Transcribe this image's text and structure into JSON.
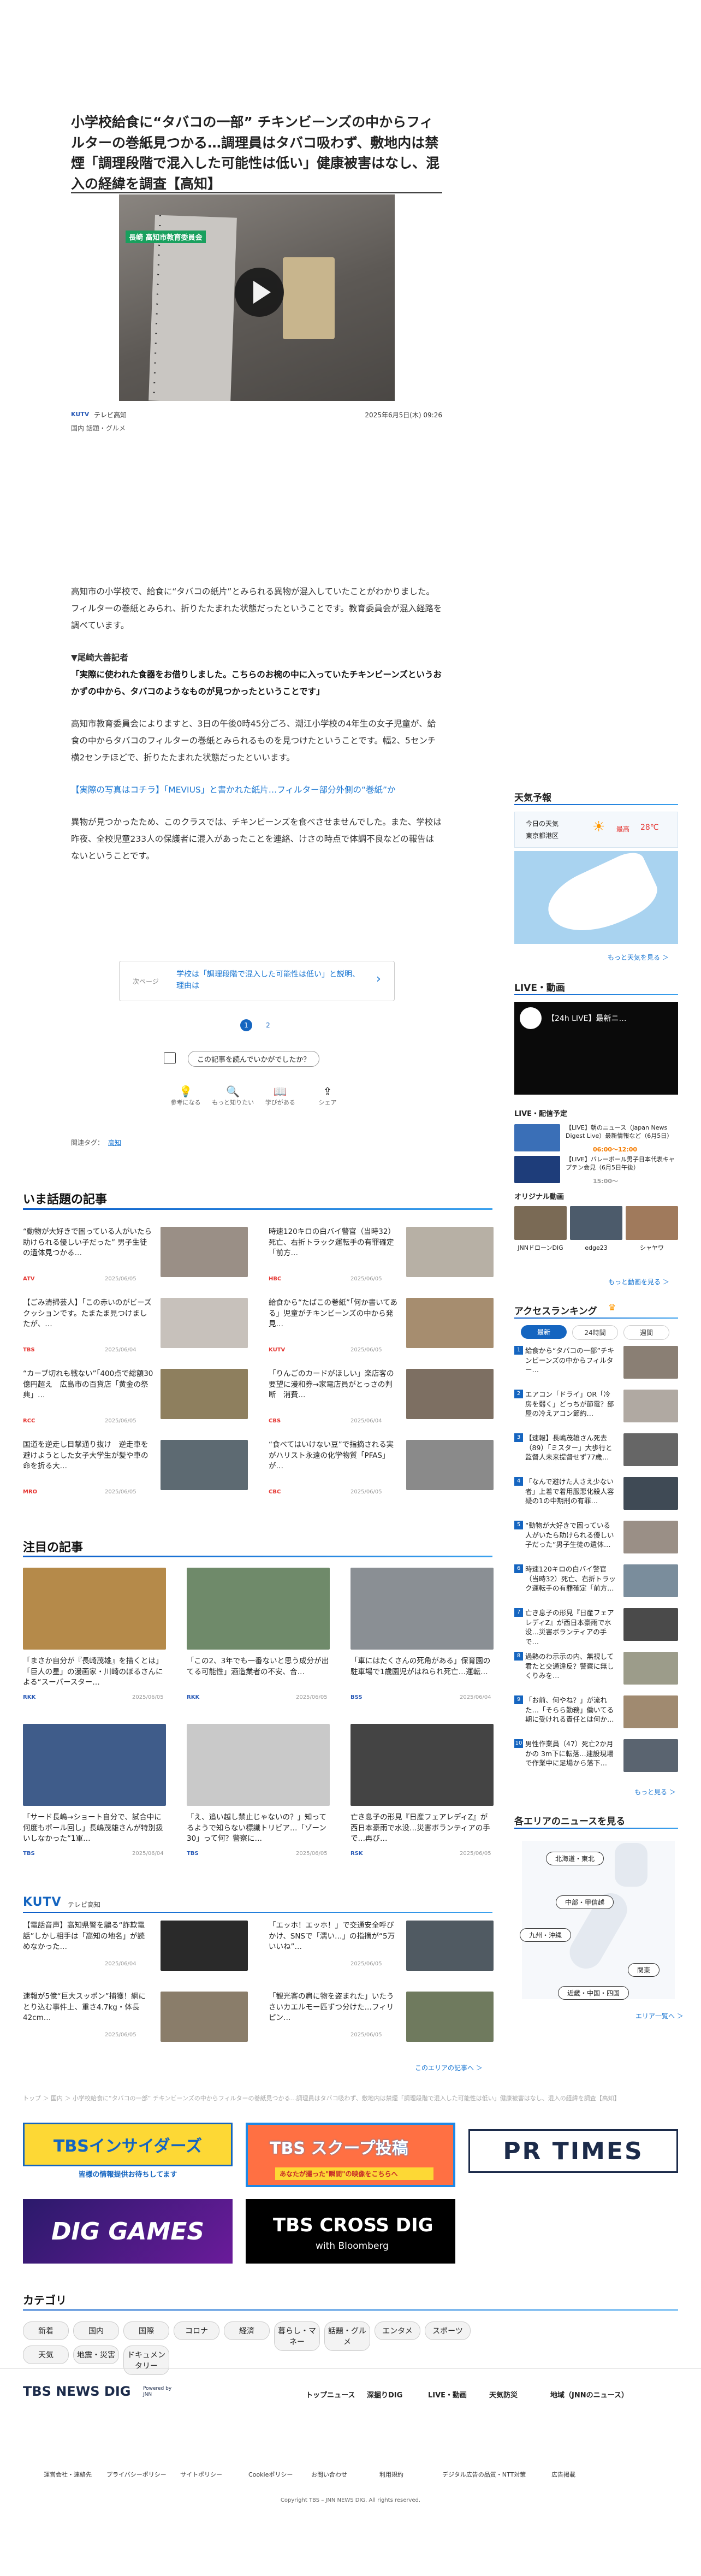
{
  "article": {
    "title": "小学校給食に“タバコの一部” チキンビーンズの中からフィルターの巻紙見つかる…調理員はタバコ吸わず、敷地内は禁煙「調理段階で混入した可能性は低い」健康被害はなし、混入の経緯を調査【高知】",
    "video_caption": "長崎 高知市教育委員会",
    "station": "テレビ高知",
    "station_logo": "KUTV",
    "date": "2025年6月5日(木) 09:26",
    "categories": "国内  話題・グルメ",
    "p1": "高知市の小学校で、給食に“タバコの紙片”とみられる異物が混入していたことがわかりました。フィルターの巻紙とみられ、折りたたまれた状態だったということです。教育委員会が混入経路を調べています。",
    "quote_head": "▼尾崎大善記者",
    "quote": "「実際に使われた食器をお借りしました。こちらのお椀の中に入っていたチキンビーンズというおかずの中から、タバコのようなものが見つかったということです」",
    "p2": "高知市教育委員会によりますと、3日の午後0時45分ごろ、潮江小学校の4年生の女子児童が、給食の中からタバコのフィルターの巻紙とみられるものを見つけたということです。幅2、5センチ横2センチほどで、折りたたまれた状態だったといいます。",
    "link": "【実際の写真はコチラ】「MEVIUS」と書かれた紙片…フィルター部分外側の“巻紙”か",
    "p3": "異物が見つかったため、このクラスでは、チキンビーンズを食べさせませんでした。また、学校は昨夜、全校児童233人の保護者に混入があったことを連絡、けさの時点で体調不良などの報告はないということです。",
    "next_label": "次ページ",
    "next_title": "学校は「調理段階で混入した可能性は低い」と説明、理由は",
    "page1": "1",
    "page2": "2",
    "feedback": "この記事を読んでいかがでしたか？",
    "reactions": [
      "参考になる",
      "もっと知りたい",
      "学びがある",
      "シェア"
    ],
    "tags_label": "関連タグ：",
    "tag": "高知"
  },
  "trending": {
    "heading": "いま話題の記事",
    "items": [
      {
        "title": "“動物が大好きで困っている人がいたら助けられる優しい子だった” 男子生徒の遺体見つかる…",
        "date": "2025/06/05",
        "src": "ATV"
      },
      {
        "title": "時速120キロの白バイ警官（当時32）死亡、右折トラック運転手の有罪確定「前方…",
        "date": "2025/06/05",
        "src": "HBC"
      },
      {
        "title": "【ごみ清掃芸人】「この赤いのがビーズクッションです。たまたま見つけましたが、…",
        "date": "2025/06/04",
        "src": "TBS"
      },
      {
        "title": "給食から“たばこの巻紙”「何か書いてある」児童がチキンビーンズの中から発見…",
        "date": "2025/06/05",
        "src": "KUTV"
      },
      {
        "title": "“カーブ切れも戦ない”「400点で総額30億円超え　広島市の百貨店「黄金の祭典」…",
        "date": "2025/06/05",
        "src": "RCC"
      },
      {
        "title": "「りんごのカードがほしい」楽店客の要望に漫和券→家電店員がとっさの判断　消費…",
        "date": "2025/06/04",
        "src": "CBS"
      },
      {
        "title": "国道を逆走し目撃通り抜け　逆走車を避けようとした女子大学生が髪や車の命を折る大…",
        "date": "2025/06/05",
        "src": "MRO"
      },
      {
        "title": "“食べてはいけない豆”で指摘される実がハリスト永遠の化学物質「PFAS」が…",
        "date": "2025/06/05",
        "src": "CBC"
      }
    ]
  },
  "featured": {
    "heading": "注目の記事",
    "items": [
      {
        "title": "「まさか自分が『長崎茂雄』を描くとは」「巨人の星」の漫画家・川崎のぼるさんによる“スーパースター…",
        "date": "2025/06/05",
        "src": "RKK"
      },
      {
        "title": "「この2、3年でも一番ないと思う成分が出てる可能性」酒造業者の不安、合…",
        "date": "2025/06/05",
        "src": "RKK"
      },
      {
        "title": "「車にはたくさんの死角がある」保育園の駐車場で1歳園児がはねられ死亡…運転…",
        "date": "2025/06/04",
        "src": "BSS"
      },
      {
        "title": "「サード長嶋→ショート自分で、試合中に何度もボール回し」長嶋茂雄さんが特別扱いしなかった“1軍…",
        "date": "2025/06/04",
        "src": "TBS"
      },
      {
        "title": "「え、追い越し禁止じゃないの？」知ってるようで知らない標識トリビア…「ゾーン30」って何？警察に…",
        "date": "2025/06/05",
        "src": "TBS"
      },
      {
        "title": "亡き息子の形見『日産フェアレディZ』が西日本豪雨で水没…災害ボランティアの手で…再び…",
        "date": "2025/06/05",
        "src": "RSK"
      }
    ]
  },
  "area": {
    "station": "テレビ高知",
    "items": [
      {
        "title": "【電話音声】高知県警を騙る“詐欺電話”しかし相手は「高知の地名」が読めなかった…",
        "date": "2025/06/04"
      },
      {
        "title": "「エッホ！エッホ！」で交通安全呼びかけ、SNSで「濡い…」の指摘が“5万いいね”…",
        "date": "2025/06/05"
      },
      {
        "title": "速報が5億“巨大スッポン”捕獲！網にとり込む事件上、重さ4.7kg・体長42cm…",
        "date": "2025/06/05"
      },
      {
        "title": "「観光客の肩に物を盗まれた」いたうさいカエルモー匹ずつ分けた…フィリピン…",
        "date": "2025/06/05"
      }
    ],
    "more": "このエリアの記事へ ＞"
  },
  "breadcrumb": "トップ ＞ 国内 ＞ 小学校給食に“タバコの一部” チキンビーンズの中からフィルターの巻紙見つかる…調理員はタバコ吸わず、敷地内は禁煙「調理段階で混入した可能性は低い」健康被害はなし、混入の経緯を調査【高知】",
  "banners": {
    "insiders": "TBSインサイダーズ",
    "insiders_sub": "皆様の情報提供お待ちしてます",
    "scoop": "TBS スクープ投稿",
    "scoop_sub": "あなたが撮った\"瞬間\"の映像をこちらへ",
    "prtimes": "PR TIMES",
    "diggames": "DIG GAMES",
    "crossdig": "TBS CROSS DIG",
    "crossdig_sub": "with Bloomberg"
  },
  "category_heading": "カテゴリ",
  "categories": [
    "新着",
    "国内",
    "国際",
    "コロナ",
    "経済",
    "暮らし・マネー",
    "話題・グルメ",
    "エンタメ",
    "スポーツ",
    "天気",
    "地震・災害",
    "ドキュメンタリー"
  ],
  "sidebar": {
    "weather_h": "天気予報",
    "weather_today": "今日の天気",
    "weather_loc": "東京都港区",
    "weather_hi_label": "最高",
    "weather_hi": "28℃",
    "weather_more": "もっと天気を見る ＞",
    "live_h": "LIVE・動画",
    "live_title": "【24h LIVE】最新ニ…",
    "live_sched": "LIVE・配信予定",
    "live_items": [
      {
        "title": "【LIVE】朝のニュース（Japan News Digest Live）最新情報など（6月5日）",
        "time": "06:00〜12:00"
      },
      {
        "title": "【LIVE】バレーボール男子日本代表キャプテン会見（6月5日午後）",
        "time": "15:00〜"
      }
    ],
    "orig_h": "オリジナル動画",
    "orig": [
      "JNNドローンDIG",
      "edge23",
      "シャヤワ"
    ],
    "orig_more": "もっと動画を見る ＞",
    "rank_h": "アクセスランキング",
    "rank_tabs": [
      "最新",
      "24時間",
      "週間"
    ],
    "rank": [
      "給食から“タバコの一部”チキンビーンズの中からフィルター…",
      "エアコン「ドライ」OR「冷房を弱く」どっちが節電？部屋の冷えアコン節約…",
      "【速報】長嶋茂雄さん死去（89）「ミスター」大歩行と監督人未来提督せず77歳…",
      "「なんで避けた人さえ少ない者」上着で着用服悪化殺人容疑の1の中期刑の有罪…",
      "“動物が大好きで困っている人がいたら助けられる優しい子だった”男子生徒の遺体…",
      "時速120キロの白バイ警官（当時32）死亡、右折トラック運転手の有罪確定「前方…",
      "亡き息子の形見『日産フェアレディZ』が西日本豪雨で水没…災害ボランティアの手で…",
      "過熱のわ示示の内、無視して君たと交通違反？警察に無しくりみを…",
      "「お前、何やね？」が流れた…「そらら勤務」働いてる期に受けれる責任とは何か…",
      "男性作業員（47）死亡2か月かの 3m下に転落…建設現場で作業中に足場から落下…"
    ],
    "rank_more": "もっと見る ＞",
    "region_h": "各エリアのニュースを見る",
    "regions": [
      "北海道・東北",
      "中部・甲信越",
      "九州・沖縄",
      "関東",
      "近畿・中国・四国"
    ],
    "region_more": "エリア一覧へ ＞"
  },
  "footer": {
    "logo": "TBS NEWS DIG",
    "powered": "Powered by JNN",
    "nav": [
      "トップニュース",
      "深掘りDIG",
      "LIVE・動画",
      "天気防災",
      "地域（JNNのニュース）"
    ],
    "links": [
      "運営会社・連絡先",
      "プライバシーポリシー",
      "サイトポリシー",
      "Cookieポリシー",
      "お問い合わせ",
      "利用規約",
      "デジタル広告の品質・NTT対策",
      "広告掲載"
    ],
    "copyright": "Copyright TBS – JNN NEWS DIG. All rights reserved."
  },
  "colors": {
    "accent": "#1565c0",
    "orange": "#f57c00",
    "red": "#e53935"
  }
}
